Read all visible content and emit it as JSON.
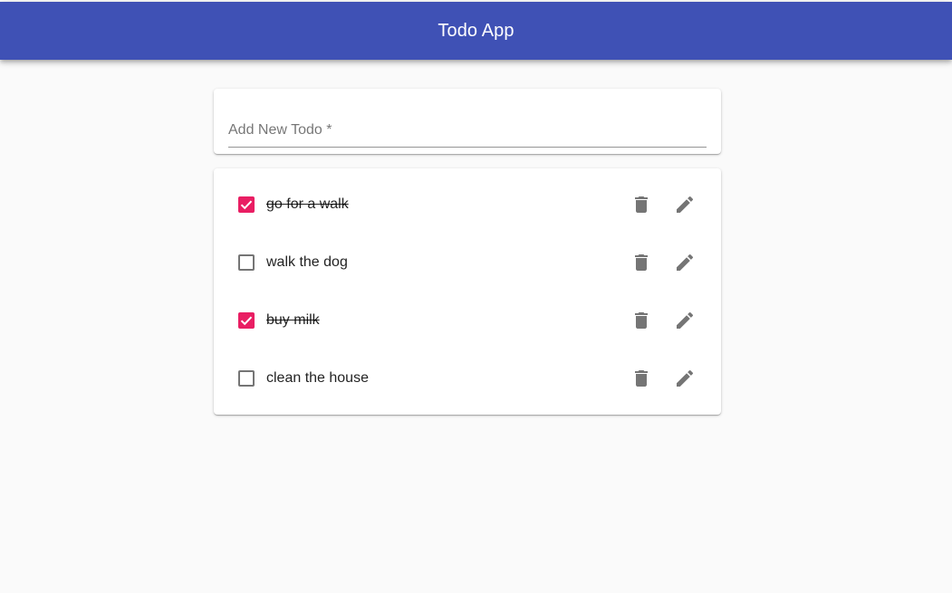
{
  "app": {
    "title": "Todo App"
  },
  "new_todo": {
    "placeholder": "Add New Todo *",
    "value": ""
  },
  "todos": [
    {
      "text": "go for a walk",
      "completed": true
    },
    {
      "text": "walk the dog",
      "completed": false
    },
    {
      "text": "buy milk",
      "completed": true
    },
    {
      "text": "clean the house",
      "completed": false
    }
  ],
  "icons": {
    "delete": "trash-icon",
    "edit": "pencil-icon"
  },
  "colors": {
    "appbar": "#3f51b5",
    "checkbox_checked": "#e91e63",
    "icon": "#757575",
    "background": "#fafafa"
  }
}
